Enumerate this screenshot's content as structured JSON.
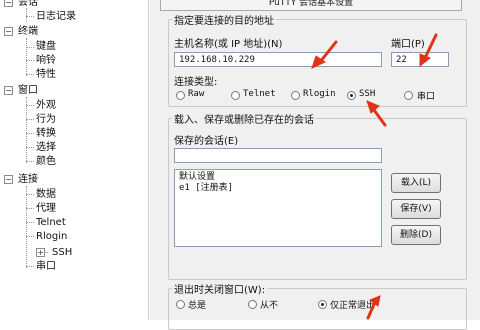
{
  "tree": {
    "items": [
      {
        "label": "会话"
      },
      {
        "label": "日志记录"
      },
      {
        "label": "终端"
      },
      {
        "label": "键盘"
      },
      {
        "label": "响铃"
      },
      {
        "label": "特性"
      },
      {
        "label": "窗口"
      },
      {
        "label": "外观"
      },
      {
        "label": "行为"
      },
      {
        "label": "转换"
      },
      {
        "label": "选择"
      },
      {
        "label": "颜色"
      },
      {
        "label": "连接"
      },
      {
        "label": "数据"
      },
      {
        "label": "代理"
      },
      {
        "label": "Telnet"
      },
      {
        "label": "Rlogin"
      },
      {
        "label": "SSH"
      },
      {
        "label": "串口"
      }
    ]
  },
  "panel": {
    "header": "PuTTY 会话基本设置",
    "target_group": "指定要连接的目的地址",
    "host_label": "主机名称(或 IP 地址)(N)",
    "host_value": "192.168.10.229",
    "port_label": "端口(P)",
    "port_value": "22",
    "conn_type_label": "连接类型:",
    "conn_types": [
      {
        "label": "Raw",
        "selected": false
      },
      {
        "label": "Telnet",
        "selected": false
      },
      {
        "label": "Rlogin",
        "selected": false
      },
      {
        "label": "SSH",
        "selected": true
      },
      {
        "label": "串口",
        "selected": false
      }
    ],
    "sessions_group": "载入、保存或删除已存在的会话",
    "saved_sessions_label": "保存的会话(E)",
    "saved_sessions_value": "",
    "sessions_list": [
      "默认设置",
      "e1 [注册表]"
    ],
    "load_button": "载入(L)",
    "save_button": "保存(V)",
    "delete_button": "删除(D)",
    "close_label": "退出时关闭窗口(W):",
    "close_options": [
      {
        "label": "总是",
        "selected": false
      },
      {
        "label": "从不",
        "selected": false
      },
      {
        "label": "仅正常退出",
        "selected": true
      }
    ]
  },
  "colors": {
    "arrow": "#e0341a",
    "panel_bg": "#f0f0f0",
    "field_border": "#8a9db5"
  }
}
